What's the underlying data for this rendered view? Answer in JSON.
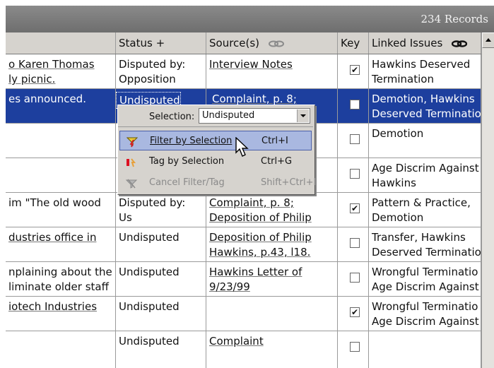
{
  "records": {
    "count_label": "234 Records"
  },
  "columns": {
    "status": "Status +",
    "source": "Source(s)",
    "key": "Key",
    "issues": "Linked Issues"
  },
  "rows": [
    {
      "desc": [
        "o Karen Thomas",
        "ly picnic."
      ],
      "status": [
        "Disputed by:",
        "Opposition"
      ],
      "source": [
        "Interview Notes",
        ""
      ],
      "key": true,
      "issues": [
        "Hawkins Deserved",
        "Termination"
      ]
    },
    {
      "desc": [
        "es announced.",
        ""
      ],
      "status": [
        "Undisputed",
        ""
      ],
      "source": [
        "Complaint, p. 8;",
        ""
      ],
      "key": false,
      "issues": [
        "Demotion, Hawkins",
        "Deserved Terminatio"
      ]
    },
    {
      "desc": [
        "",
        ""
      ],
      "status": [
        "",
        ""
      ],
      "source": [
        "",
        ""
      ],
      "key": false,
      "issues": [
        "Demotion",
        ""
      ]
    },
    {
      "desc": [
        "",
        ""
      ],
      "status": [
        "",
        ""
      ],
      "source": [
        "",
        ""
      ],
      "key": false,
      "issues": [
        "Age Discrim Against",
        "Hawkins"
      ]
    },
    {
      "desc": [
        "im \"The old wood",
        ""
      ],
      "status": [
        "Disputed by:",
        "Us"
      ],
      "source": [
        "Complaint, p. 8;",
        "Deposition of Philip"
      ],
      "key": true,
      "issues": [
        "Pattern & Practice,",
        "Demotion"
      ]
    },
    {
      "desc": [
        "dustries office in",
        ""
      ],
      "status": [
        "Undisputed",
        ""
      ],
      "source": [
        "Deposition of Philip",
        "Hawkins, p.43, l18."
      ],
      "key": false,
      "issues": [
        "Transfer, Hawkins",
        "Deserved Terminatio"
      ]
    },
    {
      "desc": [
        "nplaining about the",
        "liminate older staff"
      ],
      "status": [
        "Undisputed",
        ""
      ],
      "source": [
        "Hawkins Letter of",
        "9/23/99"
      ],
      "key": false,
      "issues": [
        "Wrongful Terminatio",
        "Age Discrim Against"
      ]
    },
    {
      "desc": [
        "iotech Industries",
        ""
      ],
      "status": [
        "Undisputed",
        ""
      ],
      "source": [
        "",
        ""
      ],
      "key": true,
      "issues": [
        "Wrongful Terminatio",
        "Age Discrim Against"
      ]
    },
    {
      "desc": [
        "",
        ""
      ],
      "status": [
        "Undisputed",
        ""
      ],
      "source": [
        "Complaint",
        ""
      ],
      "key": false,
      "issues": [
        "",
        ""
      ]
    }
  ],
  "popup": {
    "selection_label_prefix": "Selection:",
    "selection_value": "Undisputed",
    "items": [
      {
        "label": "Filter by Selection",
        "shortcut": "Ctrl+I",
        "icon": "filter-icon"
      },
      {
        "label": "Tag by Selection",
        "shortcut": "Ctrl+G",
        "icon": "tag-icon"
      },
      {
        "label": "Cancel Filter/Tag",
        "shortcut": "Shift+Ctrl+I",
        "icon": "cancel-filter-icon"
      }
    ]
  }
}
